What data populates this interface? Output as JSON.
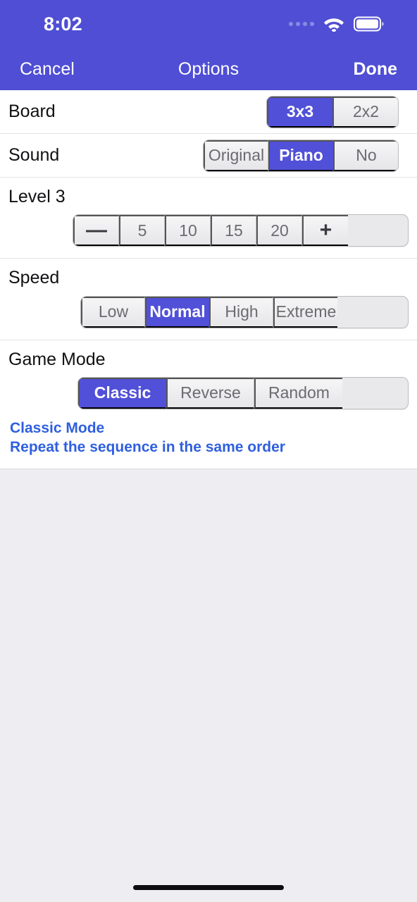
{
  "status_bar": {
    "time": "8:02",
    "signal_icon": "signal-dots-icon",
    "wifi_icon": "wifi-icon",
    "battery_icon": "battery-icon"
  },
  "nav_bar": {
    "cancel_label": "Cancel",
    "title": "Options",
    "done_label": "Done"
  },
  "colors": {
    "accent": "#5150d8",
    "navbar": "#4f4ed4",
    "hint_text": "#2f5fe0",
    "page_background": "#eeeef2",
    "row_background": "#ffffff"
  },
  "rows": [
    {
      "label": "Board",
      "options": [
        "3x3",
        "2x2"
      ],
      "selected": "3x3"
    },
    {
      "label": "Sound",
      "options": [
        "Original",
        "Piano",
        "No"
      ],
      "selected": "Piano"
    },
    {
      "label": "Level 3",
      "options": [
        "—",
        "5",
        "10",
        "15",
        "20",
        "+"
      ],
      "selected": null
    },
    {
      "label": "Speed",
      "options": [
        "Low",
        "Normal",
        "High",
        "Extreme"
      ],
      "selected": "Normal"
    },
    {
      "label": "Game Mode",
      "options": [
        "Classic",
        "Reverse",
        "Random"
      ],
      "selected": "Classic",
      "hint_title": "Classic Mode",
      "hint_body": "Repeat the sequence in the same order"
    }
  ]
}
